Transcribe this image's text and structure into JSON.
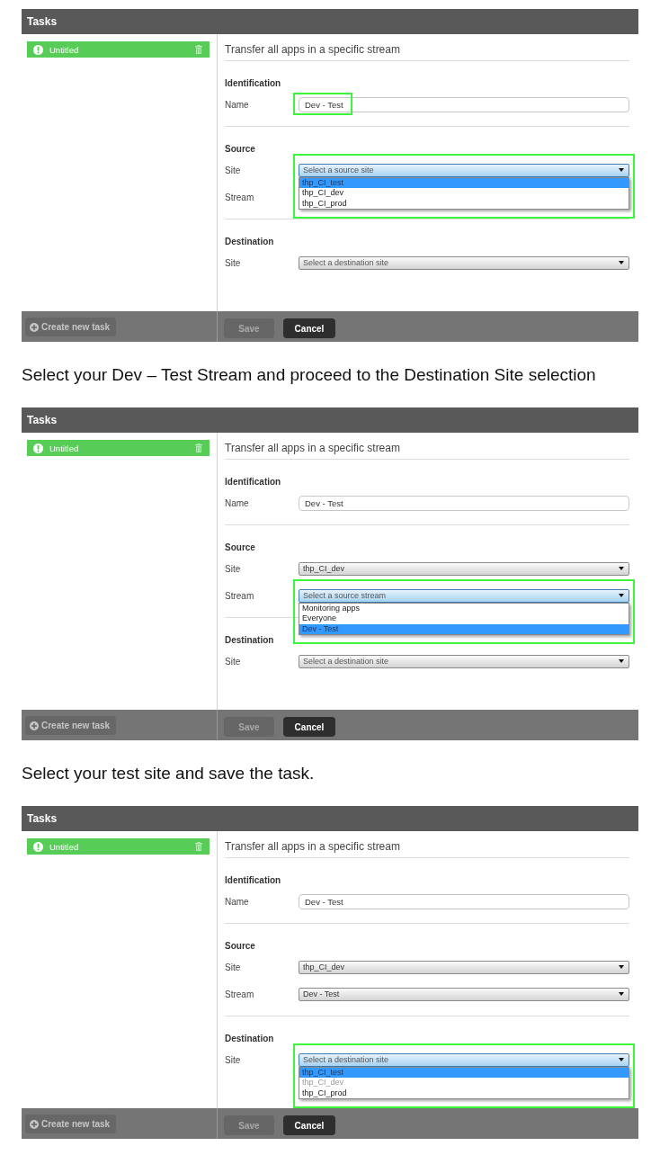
{
  "blocks": [
    {
      "kind": "screenshot",
      "header": "Tasks",
      "tasks": [
        {
          "label": "Untitled",
          "selected": true
        }
      ],
      "heading": "Transfer all apps in a specific stream",
      "groups": [
        {
          "title": "Identification",
          "fields": [
            {
              "kind": "text",
              "label": "Name",
              "value": "Dev - Test",
              "highlighted": true
            }
          ]
        },
        {
          "title": "Source",
          "fields": [
            {
              "kind": "select",
              "label": "Site",
              "placeholder": "Select a source site",
              "open": true,
              "highlighted": true,
              "options": [
                {
                  "label": "thp_CI_test",
                  "selected": true,
                  "disabled": false
                },
                {
                  "label": "thp_CI_dev",
                  "selected": false,
                  "disabled": false
                },
                {
                  "label": "thp_CI_prod",
                  "selected": false,
                  "disabled": false
                }
              ]
            },
            {
              "kind": "select",
              "label": "Stream"
            }
          ]
        },
        {
          "title": "Destination",
          "fields": [
            {
              "kind": "select",
              "label": "Site",
              "placeholder": "Select a destination site",
              "open": false,
              "highlighted": false
            }
          ]
        }
      ],
      "footer": {
        "create_button": "Create new task",
        "save_button": {
          "label": "Save",
          "disabled": true
        },
        "cancel_button": "Cancel"
      }
    },
    {
      "kind": "caption",
      "text": "Select your Dev – Test Stream and proceed to the Destination Site selection"
    },
    {
      "kind": "screenshot",
      "header": "Tasks",
      "tasks": [
        {
          "label": "Untitled",
          "selected": true
        }
      ],
      "heading": "Transfer all apps in a specific stream",
      "groups": [
        {
          "title": "Identification",
          "fields": [
            {
              "kind": "text",
              "label": "Name",
              "value": "Dev - Test",
              "highlighted": false
            }
          ]
        },
        {
          "title": "Source",
          "fields": [
            {
              "kind": "select",
              "label": "Site",
              "value": "thp_CI_dev",
              "open": false,
              "highlighted": false
            },
            {
              "kind": "select",
              "label": "Stream",
              "placeholder": "Select a source stream",
              "open": true,
              "highlighted": true,
              "options": [
                {
                  "label": "Monitoring apps",
                  "selected": false,
                  "disabled": false
                },
                {
                  "label": "Everyone",
                  "selected": false,
                  "disabled": false
                },
                {
                  "label": "Dev - Test",
                  "selected": true,
                  "disabled": false
                }
              ]
            }
          ]
        },
        {
          "title": "Destination",
          "fields": [
            {
              "kind": "select",
              "label": "Site",
              "placeholder": "Select a destination site",
              "open": false,
              "highlighted": false
            }
          ]
        }
      ],
      "footer": {
        "create_button": "Create new task",
        "save_button": {
          "label": "Save",
          "disabled": true
        },
        "cancel_button": "Cancel"
      }
    },
    {
      "kind": "caption",
      "text": "Select your test site and save the task."
    },
    {
      "kind": "screenshot",
      "header": "Tasks",
      "tasks": [
        {
          "label": "Untitled",
          "selected": true
        }
      ],
      "heading": "Transfer all apps in a specific stream",
      "groups": [
        {
          "title": "Identification",
          "fields": [
            {
              "kind": "text",
              "label": "Name",
              "value": "Dev - Test",
              "highlighted": false
            }
          ]
        },
        {
          "title": "Source",
          "fields": [
            {
              "kind": "select",
              "label": "Site",
              "value": "thp_CI_dev",
              "open": false,
              "highlighted": false
            },
            {
              "kind": "select",
              "label": "Stream",
              "value": "Dev - Test",
              "open": false,
              "highlighted": false
            }
          ]
        },
        {
          "title": "Destination",
          "fields": [
            {
              "kind": "select",
              "label": "Site",
              "placeholder": "Select a destination site",
              "open": true,
              "highlighted": true,
              "options": [
                {
                  "label": "thp_CI_test",
                  "selected": true,
                  "disabled": false
                },
                {
                  "label": "thp_CI_dev",
                  "selected": false,
                  "disabled": true
                },
                {
                  "label": "thp_CI_prod",
                  "selected": false,
                  "disabled": false
                }
              ]
            }
          ]
        }
      ],
      "footer": {
        "create_button": "Create new task",
        "save_button": {
          "label": "Save",
          "disabled": true
        },
        "cancel_button": "Cancel"
      }
    }
  ]
}
